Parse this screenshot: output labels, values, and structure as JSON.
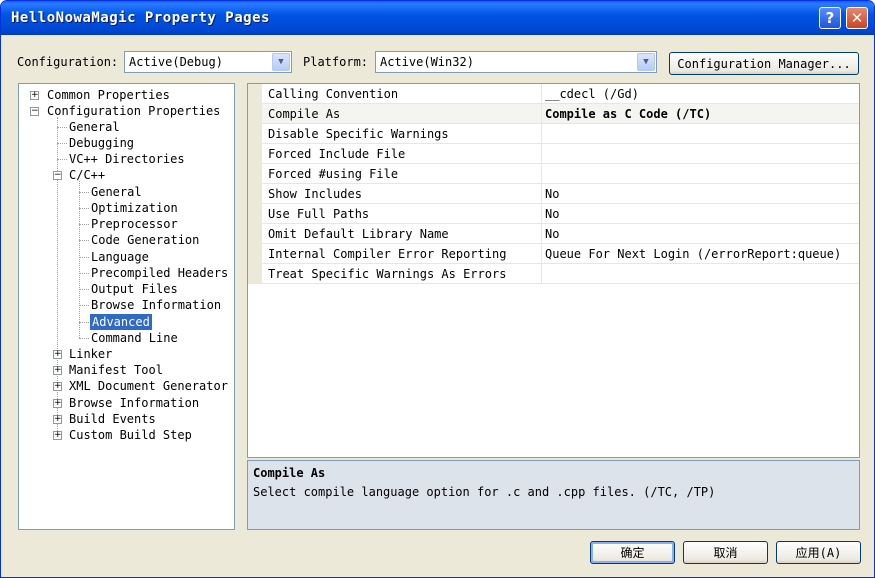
{
  "window": {
    "title": "HelloNowaMagic Property Pages"
  },
  "toolbar": {
    "configuration_label": "Configuration:",
    "configuration_value": "Active(Debug)",
    "platform_label": "Platform:",
    "platform_value": "Active(Win32)",
    "config_manager_label": "Configuration Manager..."
  },
  "tree": {
    "common_properties": "Common Properties",
    "configuration_properties": "Configuration Properties",
    "general": "General",
    "debugging": "Debugging",
    "vc_directories": "VC++ Directories",
    "cpp": "C/C++",
    "cpp_children": [
      "General",
      "Optimization",
      "Preprocessor",
      "Code Generation",
      "Language",
      "Precompiled Headers",
      "Output Files",
      "Browse Information",
      "Advanced",
      "Command Line"
    ],
    "after": [
      "Linker",
      "Manifest Tool",
      "XML Document Generator",
      "Browse Information",
      "Build Events",
      "Custom Build Step"
    ]
  },
  "properties": [
    {
      "name": "Calling Convention",
      "value": "__cdecl (/Gd)"
    },
    {
      "name": "Compile As",
      "value": "Compile as C Code (/TC)"
    },
    {
      "name": "Disable Specific Warnings",
      "value": ""
    },
    {
      "name": "Forced Include File",
      "value": ""
    },
    {
      "name": "Forced #using File",
      "value": ""
    },
    {
      "name": "Show Includes",
      "value": "No"
    },
    {
      "name": "Use Full Paths",
      "value": "No"
    },
    {
      "name": "Omit Default Library Name",
      "value": "No"
    },
    {
      "name": "Internal Compiler Error Reporting",
      "value": "Queue For Next Login (/errorReport:queue)"
    },
    {
      "name": "Treat Specific Warnings As Errors",
      "value": ""
    }
  ],
  "description": {
    "title": "Compile As",
    "text": "Select compile language option for .c and .cpp files.  (/TC, /TP)"
  },
  "buttons": {
    "ok": "确定",
    "cancel": "取消",
    "apply": "应用(A)"
  }
}
